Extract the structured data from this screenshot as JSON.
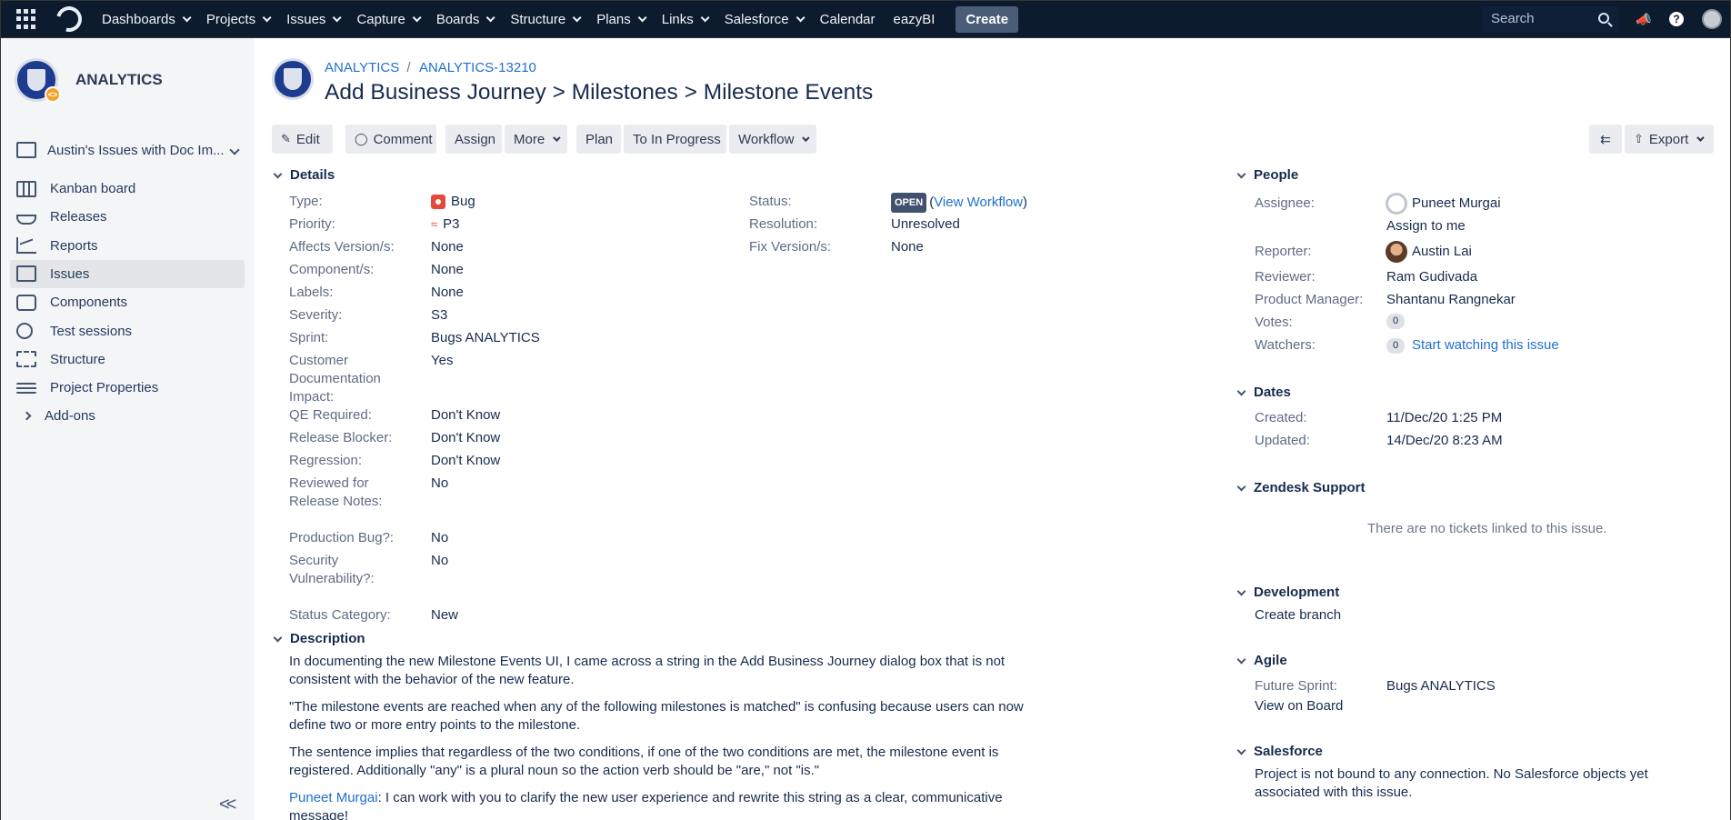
{
  "nav": {
    "items": [
      {
        "label": "Dashboards",
        "caret": true
      },
      {
        "label": "Projects",
        "caret": true
      },
      {
        "label": "Issues",
        "caret": true
      },
      {
        "label": "Capture",
        "caret": true
      },
      {
        "label": "Boards",
        "caret": true
      },
      {
        "label": "Structure",
        "caret": true
      },
      {
        "label": "Plans",
        "caret": true
      },
      {
        "label": "Links",
        "caret": true
      },
      {
        "label": "Salesforce",
        "caret": true
      },
      {
        "label": "Calendar",
        "caret": false
      },
      {
        "label": "eazyBI",
        "caret": false
      }
    ],
    "create_label": "Create",
    "search_placeholder": "Search"
  },
  "sidebar": {
    "project_name": "ANALYTICS",
    "board_selector": "Austin's Issues with Doc Im...",
    "items": [
      {
        "label": "Kanban board",
        "icon": "kanban-icon"
      },
      {
        "label": "Releases",
        "icon": "ship-icon"
      },
      {
        "label": "Reports",
        "icon": "chart-icon"
      },
      {
        "label": "Issues",
        "icon": "issues-icon"
      },
      {
        "label": "Components",
        "icon": "puzzle-icon"
      },
      {
        "label": "Test sessions",
        "icon": "bug-icon"
      },
      {
        "label": "Structure",
        "icon": "structure-icon"
      },
      {
        "label": "Project Properties",
        "icon": "list-icon"
      }
    ],
    "addons_label": "Add-ons",
    "collapse_glyph": "<<"
  },
  "issue": {
    "breadcrumb_project": "ANALYTICS",
    "breadcrumb_sep": "/",
    "breadcrumb_key": "ANALYTICS-13210",
    "title": "Add Business Journey > Milestones > Milestone Events"
  },
  "toolbar": {
    "edit": "Edit",
    "comment": "Comment",
    "assign": "Assign",
    "more": "More",
    "plan": "Plan",
    "to_in_progress": "To In Progress",
    "workflow": "Workflow",
    "export": "Export"
  },
  "details": {
    "heading": "Details",
    "left": [
      {
        "label": "Type:",
        "value": "Bug"
      },
      {
        "label": "Priority:",
        "value": "P3"
      },
      {
        "label": "Affects Version/s:",
        "value": "None"
      },
      {
        "label": "Component/s:",
        "value": "None"
      },
      {
        "label": "Labels:",
        "value": "None"
      },
      {
        "label": "Severity:",
        "value": "S3"
      },
      {
        "label": "Sprint:",
        "value": "Bugs ANALYTICS"
      },
      {
        "label": "Customer Documentation Impact:",
        "value": "Yes"
      },
      {
        "label": "QE Required:",
        "value": "Don't Know"
      },
      {
        "label": "Release Blocker:",
        "value": "Don't Know"
      },
      {
        "label": "Regression:",
        "value": "Don't Know"
      },
      {
        "label": "Reviewed for Release Notes:",
        "value": "No"
      },
      {
        "label": "Production Bug?:",
        "value": "No"
      },
      {
        "label": "Security Vulnerability?:",
        "value": "No"
      },
      {
        "label": "Status Category:",
        "value": "New"
      }
    ],
    "status_label": "Status:",
    "status_value": "OPEN",
    "view_workflow": "View Workflow",
    "resolution_label": "Resolution:",
    "resolution_value": "Unresolved",
    "fix_label": "Fix Version/s:",
    "fix_value": "None"
  },
  "description": {
    "heading": "Description",
    "paragraphs": [
      "In documenting the new Milestone Events UI, I came across a string in the Add Business Journey dialog box that is not consistent with the behavior of the new feature.",
      "\"The milestone events are reached when any of the following milestones is matched\" is confusing because users can now define two or more entry points to the milestone.",
      "The sentence implies that regardless of the two conditions, if one of the two conditions are met, the milestone event is registered. Additionally \"any\" is a plural noun so the action verb should be \"are,\" not \"is.\""
    ],
    "mention": "Puneet Murgai",
    "mention_text": ": I can work with you to clarify the new user experience and rewrite this string as a clear, communicative message!"
  },
  "people": {
    "heading": "People",
    "assignee_label": "Assignee:",
    "assignee": "Puneet Murgai",
    "assign_to_me": "Assign to me",
    "reporter_label": "Reporter:",
    "reporter": "Austin Lai",
    "reviewer_label": "Reviewer:",
    "reviewer": "Ram Gudivada",
    "pm_label": "Product Manager:",
    "pm": "Shantanu Rangnekar",
    "votes_label": "Votes:",
    "votes": "0",
    "watchers_label": "Watchers:",
    "watchers": "0",
    "watch_link": "Start watching this issue"
  },
  "dates": {
    "heading": "Dates",
    "created_label": "Created:",
    "created": "11/Dec/20 1:25 PM",
    "updated_label": "Updated:",
    "updated": "14/Dec/20 8:23 AM"
  },
  "zendesk": {
    "heading": "Zendesk Support",
    "empty": "There are no tickets linked to this issue."
  },
  "development": {
    "heading": "Development",
    "create_branch": "Create branch"
  },
  "agile": {
    "heading": "Agile",
    "future_sprint_label": "Future Sprint:",
    "future_sprint": "Bugs ANALYTICS",
    "view_on_board": "View on Board"
  },
  "salesforce": {
    "heading": "Salesforce",
    "text": "Project is not bound to any connection. No Salesforce objects yet associated with this issue."
  },
  "colors": {
    "nav_bg": "#0d1b2e",
    "link": "#1f6fd0",
    "bug": "#e5493a",
    "lozenge": "#42526e"
  }
}
